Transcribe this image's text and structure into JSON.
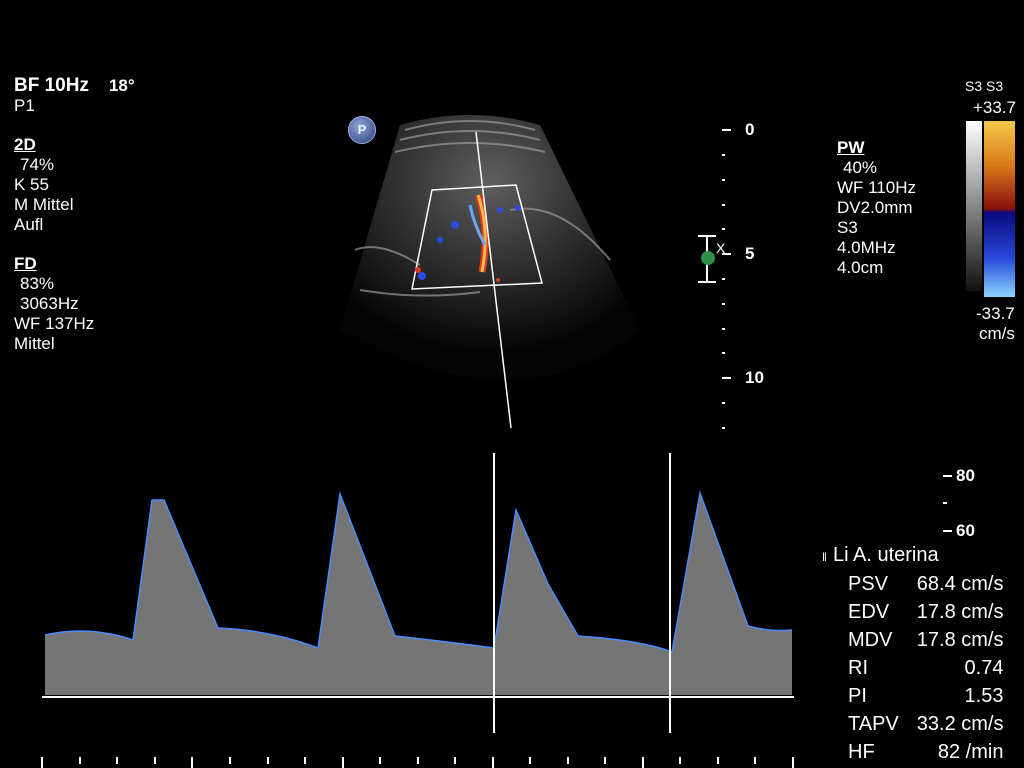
{
  "left_panel": {
    "mode": "BF 10Hz",
    "angle": "18°",
    "preset": "P1",
    "section_2d": {
      "title": "2D",
      "gain": "74%",
      "k": "K 55",
      "m": "M Mittel",
      "aufl": "Aufl"
    },
    "section_fd": {
      "title": "FD",
      "gain": "83%",
      "prf": "3063Hz",
      "wf": "WF 137Hz",
      "level": "Mittel"
    }
  },
  "pw_panel": {
    "title": "PW",
    "gain": "40%",
    "wf": "WF 110Hz",
    "dv": "DV2.0mm",
    "s": "S3",
    "freq": "4.0MHz",
    "depth": "4.0cm"
  },
  "color_scale": {
    "labels": "S3 S3",
    "max": "+33.7",
    "min": "-33.7",
    "unit": "cm/s"
  },
  "depth_scale": {
    "d0": "0",
    "d5": "5",
    "d10": "10"
  },
  "spectral_scale": {
    "top": "80",
    "mid": "60"
  },
  "badge": {
    "p": "P"
  },
  "sample_marker": "X",
  "measurements": {
    "title": "Li A. uterina",
    "items": [
      {
        "label": "PSV",
        "value": "68.4 cm/s"
      },
      {
        "label": "EDV",
        "value": "17.8 cm/s"
      },
      {
        "label": "MDV",
        "value": "17.8 cm/s"
      },
      {
        "label": "RI",
        "value": "0.74"
      },
      {
        "label": "PI",
        "value": "1.53"
      },
      {
        "label": "TAPV",
        "value": "33.2 cm/s"
      },
      {
        "label": "HF",
        "value": "82 /min"
      }
    ]
  },
  "colors": {
    "background": "#000000",
    "envelope": "#4a8cff",
    "flow_red": "#d93a1a",
    "flow_blue": "#2a4ae0",
    "marker_green": "#2e8f4a"
  }
}
